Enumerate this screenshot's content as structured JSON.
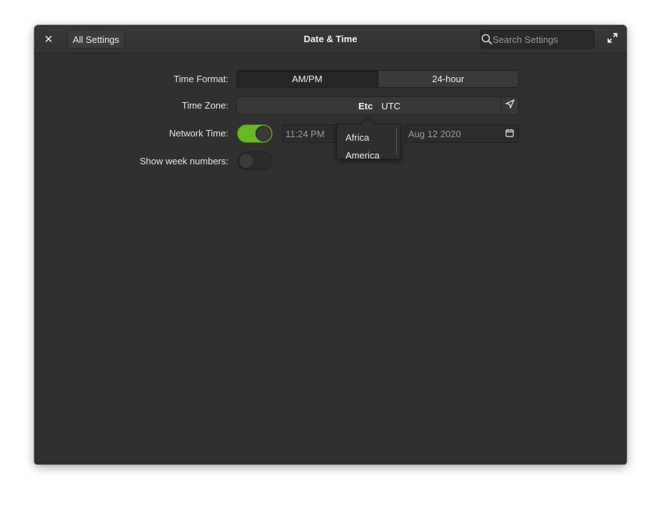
{
  "header": {
    "close_icon": "close-icon",
    "back_label": "All Settings",
    "title": "Date & Time",
    "search_placeholder": "Search Settings",
    "maximize_icon": "maximize-icon"
  },
  "time_format": {
    "label": "Time Format:",
    "options": [
      "AM/PM",
      "24-hour"
    ],
    "selected": "AM/PM"
  },
  "time_zone": {
    "label": "Time Zone:",
    "region": "Etc",
    "city": "UTC",
    "locate_icon": "location-arrow-icon"
  },
  "network_time": {
    "label": "Network Time:",
    "enabled": true,
    "time": "11:24 PM",
    "date": "Aug 12 2020"
  },
  "week_numbers": {
    "label": "Show week numbers:",
    "enabled": false
  },
  "timezone_popover": {
    "items": [
      "Africa",
      "America"
    ]
  },
  "colors": {
    "accent_green": "#68b723",
    "window_bg": "#303030"
  }
}
